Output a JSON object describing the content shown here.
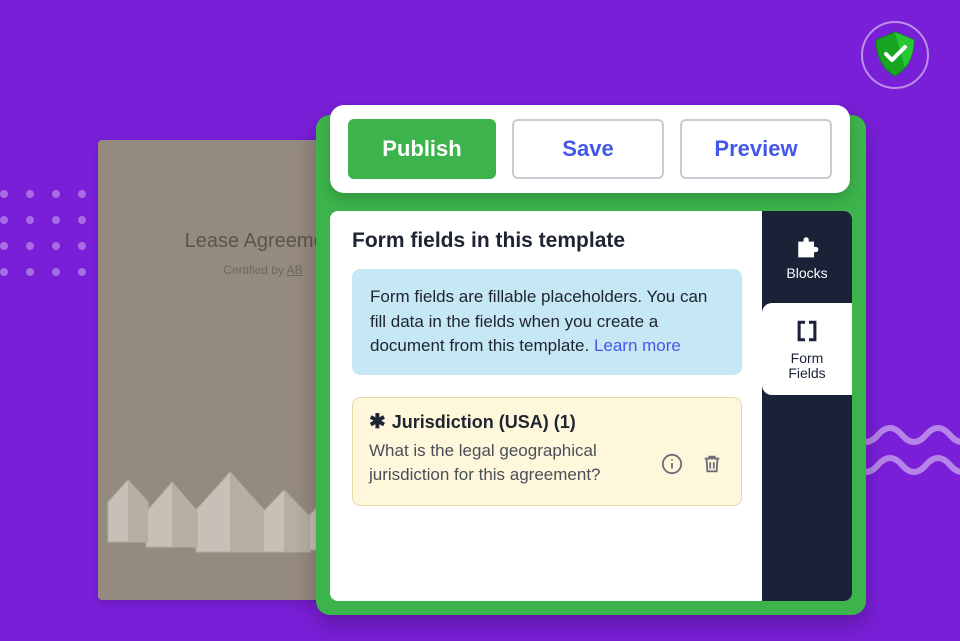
{
  "toolbar": {
    "publish_label": "Publish",
    "save_label": "Save",
    "preview_label": "Preview"
  },
  "document": {
    "title": "Lease Agreement",
    "certified_prefix": "Certified by ",
    "certified_by": "AB"
  },
  "panel": {
    "heading": "Form fields in this template",
    "info_text": "Form fields are fillable placeholders. You can fill data in the fields when you create a document from this template. ",
    "learn_more": "Learn more"
  },
  "field": {
    "name": "Jurisdiction (USA) (1)",
    "description": "What is the legal geographical jurisdiction for this agreement?"
  },
  "sidebar": {
    "blocks_label": "Blocks",
    "form_fields_label_line1": "Form",
    "form_fields_label_line2": "Fields"
  },
  "colors": {
    "bg": "#7a1fd8",
    "green": "#3cb44b",
    "link": "#4557e8",
    "navy": "#1a2238"
  }
}
